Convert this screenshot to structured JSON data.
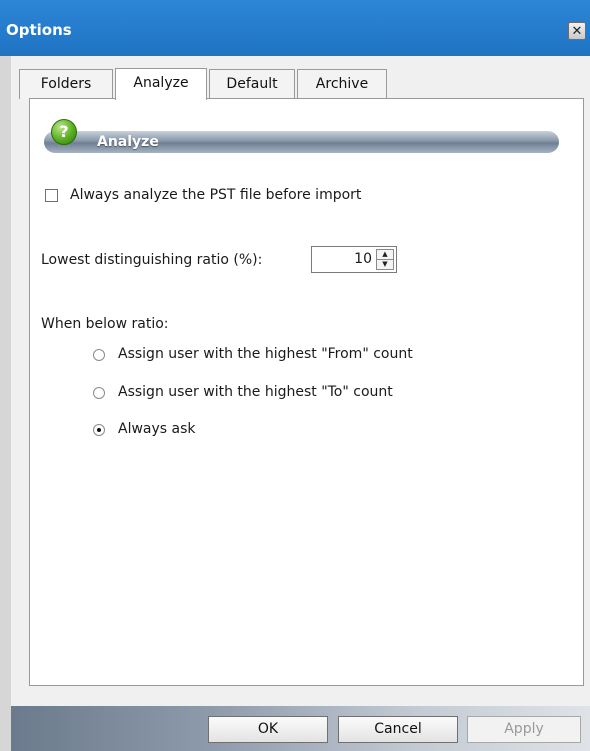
{
  "window": {
    "title": "Options",
    "close_glyph": "✕"
  },
  "tabs": [
    {
      "label": "Folders",
      "active": false
    },
    {
      "label": "Analyze",
      "active": true
    },
    {
      "label": "Default",
      "active": false
    },
    {
      "label": "Archive",
      "active": false
    }
  ],
  "section": {
    "title": "Analyze",
    "icon": "help-icon",
    "icon_glyph": "?"
  },
  "options": {
    "always_analyze_label": "Always analyze the PST file before import",
    "always_analyze_checked": false,
    "ratio_label": "Lowest distinguishing ratio (%):",
    "ratio_value": "10",
    "below_ratio_label": "When below ratio:",
    "radios": [
      {
        "label": "Assign user with the highest \"From\" count",
        "selected": false
      },
      {
        "label": "Assign user with the highest \"To\" count",
        "selected": false
      },
      {
        "label": "Always ask",
        "selected": true
      }
    ]
  },
  "buttons": {
    "ok": "OK",
    "cancel": "Cancel",
    "apply": "Apply",
    "apply_enabled": false
  },
  "colors": {
    "titlebar": "#1f73c3",
    "help_icon": "#5aae1e"
  }
}
